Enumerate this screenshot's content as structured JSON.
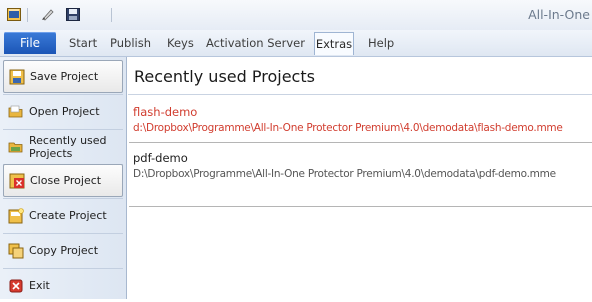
{
  "app": {
    "title": "All-In-One"
  },
  "quick_access": [
    {
      "icon": "app-menu-icon"
    },
    {
      "icon": "edit-icon"
    },
    {
      "icon": "save-icon"
    }
  ],
  "ribbon": {
    "file_label": "File",
    "tabs": [
      "Start",
      "Publish",
      "Keys",
      "Activation Server",
      "Extras",
      "Help"
    ],
    "selected_tab": "Extras"
  },
  "sidebar": {
    "items": [
      {
        "label": "Save Project",
        "icon": "save-project-icon"
      },
      {
        "label": "Open Project",
        "icon": "open-folder-icon"
      },
      {
        "label": "Recently used Projects",
        "icon": "recent-folder-icon"
      },
      {
        "label": "Close Project",
        "icon": "close-project-icon"
      },
      {
        "label": "Create Project",
        "icon": "create-project-icon"
      },
      {
        "label": "Copy Project",
        "icon": "copy-project-icon"
      },
      {
        "label": "Exit",
        "icon": "exit-icon"
      }
    ],
    "active_items": [
      "Save Project",
      "Close Project"
    ]
  },
  "main": {
    "title": "Recently used Projects",
    "projects": [
      {
        "name": "flash-demo",
        "path": "d:\\Dropbox\\Programme\\All-In-One Protector Premium\\4.0\\demodata\\flash-demo.mme"
      },
      {
        "name": "pdf-demo",
        "path": "D:\\Dropbox\\Programme\\All-In-One Protector Premium\\4.0\\demodata\\pdf-demo.mme"
      }
    ]
  },
  "colors": {
    "accent": "#1b55b6",
    "highlight_text": "#d13d2f"
  }
}
